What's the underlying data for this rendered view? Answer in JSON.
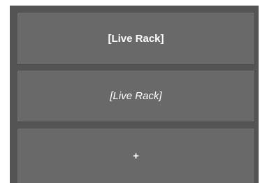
{
  "rack_slots": [
    {
      "label": "[Live Rack]",
      "style": "bold"
    },
    {
      "label": "[Live Rack]",
      "style": "italic"
    }
  ],
  "add_slot": {
    "label": "+"
  },
  "colors": {
    "panel_background": "#545454",
    "slot_background": "#696969",
    "text": "#ffffff"
  }
}
